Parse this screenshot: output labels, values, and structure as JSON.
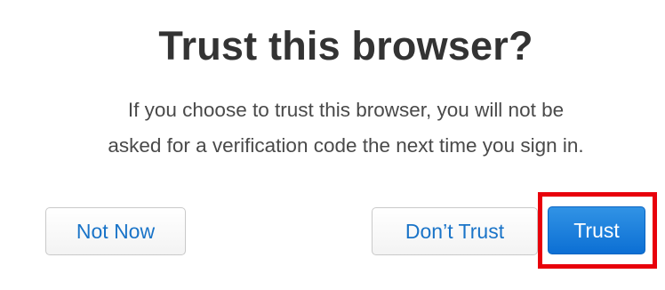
{
  "dialog": {
    "title": "Trust this browser?",
    "message_line1": "If you choose to trust this browser, you will not be",
    "message_line2": "asked for a verification code the next time you sign in.",
    "buttons": {
      "not_now": "Not Now",
      "dont_trust": "Don’t Trust",
      "trust": "Trust"
    }
  },
  "colors": {
    "title_text": "#333333",
    "secondary_button_text": "#1a74c8",
    "primary_button_bg": "#1680de",
    "highlight_border": "#e8000b"
  }
}
